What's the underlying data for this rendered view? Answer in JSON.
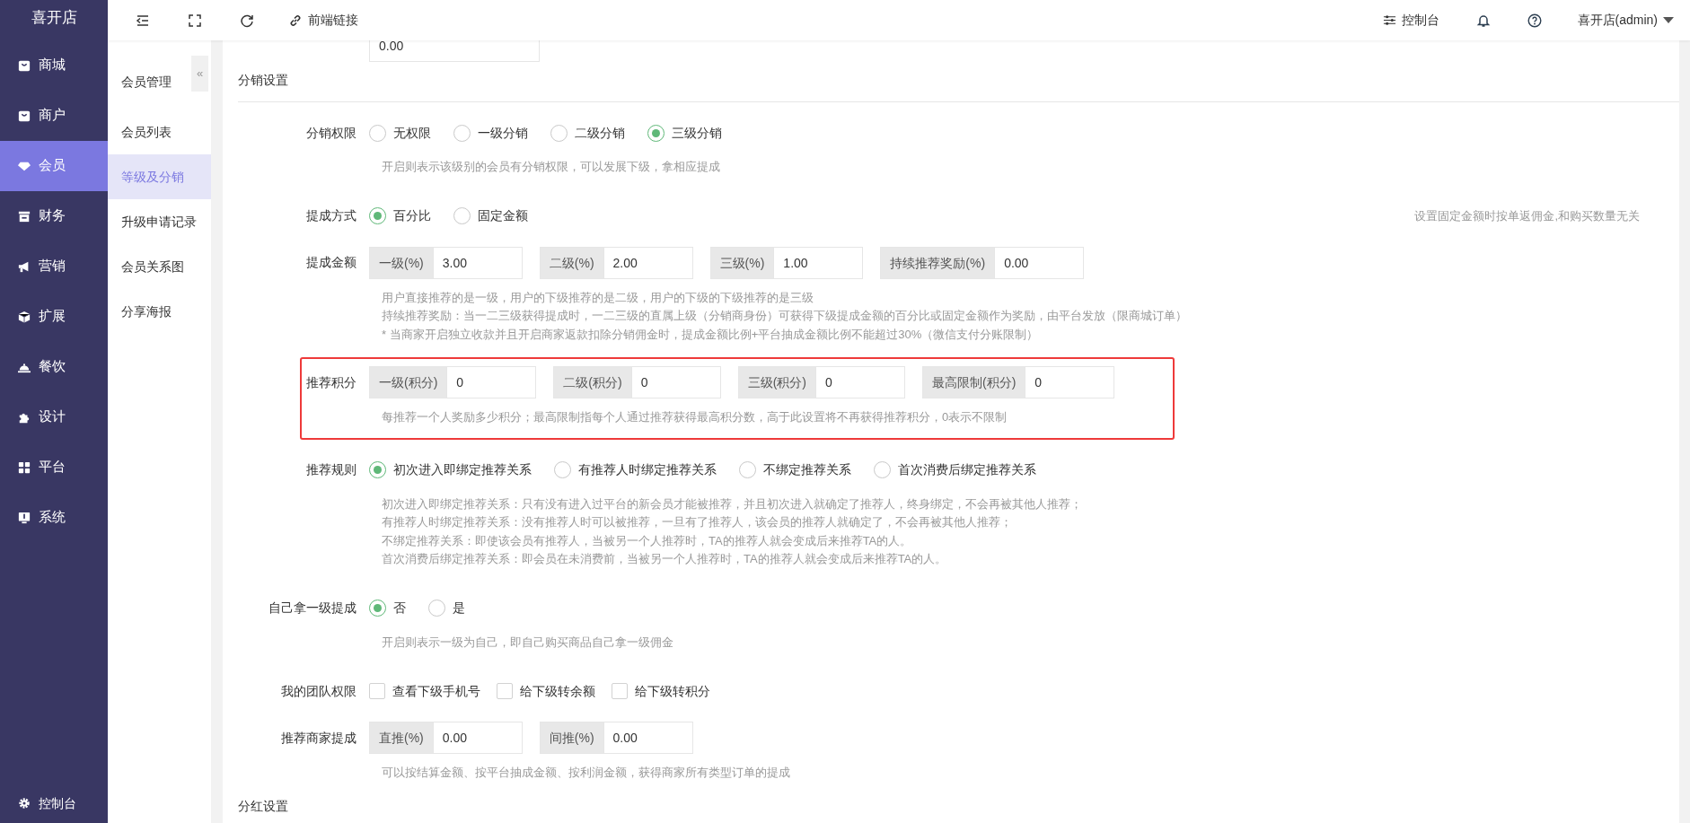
{
  "app": {
    "logo": "喜开店"
  },
  "sidebar": {
    "items": [
      {
        "label": "商城",
        "selected": false
      },
      {
        "label": "商户",
        "selected": false
      },
      {
        "label": "会员",
        "selected": true
      },
      {
        "label": "财务",
        "selected": false
      },
      {
        "label": "营销",
        "selected": false
      },
      {
        "label": "扩展",
        "selected": false
      },
      {
        "label": "餐饮",
        "selected": false
      },
      {
        "label": "设计",
        "selected": false
      },
      {
        "label": "平台",
        "selected": false
      },
      {
        "label": "系统",
        "selected": false
      }
    ],
    "footer": "控制台"
  },
  "toolbar": {
    "link": "前端链接",
    "console": "控制台",
    "user": "喜开店(admin)"
  },
  "subnav": {
    "title": "会员管理",
    "collapse": "«",
    "items": [
      {
        "label": "会员列表",
        "selected": false
      },
      {
        "label": "等级及分销",
        "selected": true
      },
      {
        "label": "升级申请记录",
        "selected": false
      },
      {
        "label": "会员关系图",
        "selected": false
      },
      {
        "label": "分享海报",
        "selected": false
      }
    ]
  },
  "form": [
    {
      "kind": "input",
      "value": "0.00"
    },
    {
      "kind": "section",
      "title": "分销设置"
    },
    {
      "kind": "radio",
      "label": "分销权限",
      "options": [
        {
          "label": "无权限",
          "selected": false
        },
        {
          "label": "一级分销",
          "selected": false
        },
        {
          "label": "二级分销",
          "selected": false
        },
        {
          "label": "三级分销",
          "selected": true
        }
      ],
      "hints": [
        "开启则表示该级别的会员有分销权限，可以发展下级，拿相应提成"
      ]
    },
    {
      "kind": "radio",
      "label": "提成方式",
      "options": [
        {
          "label": "百分比",
          "selected": true
        },
        {
          "label": "固定金额",
          "selected": false
        }
      ],
      "side_note": "设置固定金额时按单返佣金,和购买数量无关"
    },
    {
      "kind": "groups",
      "label": "提成金额",
      "groups": [
        {
          "addon": "一级(%)",
          "value": "3.00"
        },
        {
          "addon": "二级(%)",
          "value": "2.00"
        },
        {
          "addon": "三级(%)",
          "value": "1.00"
        },
        {
          "addon": "持续推荐奖励(%)",
          "value": "0.00"
        }
      ],
      "hints": [
        "用户直接推荐的是一级，用户的下级推荐的是二级，用户的下级的下级推荐的是三级",
        "持续推荐奖励：当一二三级获得提成时，一二三级的直属上级（分销商身份）可获得下级提成金额的百分比或固定金额作为奖励，由平台发放（限商城订单）",
        "* 当商家开启独立收款并且开启商家返款扣除分销佣金时，提成金额比例+平台抽成金额比例不能超过30%（微信支付分账限制）"
      ]
    },
    {
      "kind": "groups",
      "label": "推荐积分",
      "highlighted": true,
      "groups": [
        {
          "addon": "一级(积分)",
          "value": "0"
        },
        {
          "addon": "二级(积分)",
          "value": "0"
        },
        {
          "addon": "三级(积分)",
          "value": "0"
        },
        {
          "addon": "最高限制(积分)",
          "value": "0"
        }
      ],
      "hints": [
        "每推荐一个人奖励多少积分；最高限制指每个人通过推荐获得最高积分数，高于此设置将不再获得推荐积分，0表示不限制"
      ]
    },
    {
      "kind": "radio",
      "label": "推荐规则",
      "options": [
        {
          "label": "初次进入即绑定推荐关系",
          "selected": true
        },
        {
          "label": "有推荐人时绑定推荐关系",
          "selected": false
        },
        {
          "label": "不绑定推荐关系",
          "selected": false
        },
        {
          "label": "首次消费后绑定推荐关系",
          "selected": false
        }
      ],
      "hints": [
        "初次进入即绑定推荐关系：只有没有进入过平台的新会员才能被推荐，并且初次进入就确定了推荐人，终身绑定，不会再被其他人推荐；",
        "有推荐人时绑定推荐关系：没有推荐人时可以被推荐，一旦有了推荐人，该会员的推荐人就确定了，不会再被其他人推荐；",
        "不绑定推荐关系：即使该会员有推荐人，当被另一个人推荐时，TA的推荐人就会变成后来推荐TA的人。",
        "首次消费后绑定推荐关系：即会员在未消费前，当被另一个人推荐时，TA的推荐人就会变成后来推荐TA的人。"
      ]
    },
    {
      "kind": "radio",
      "label": "自己拿一级提成",
      "options": [
        {
          "label": "否",
          "selected": true
        },
        {
          "label": "是",
          "selected": false
        }
      ],
      "hints": [
        "开启则表示一级为自己，即自己购买商品自己拿一级佣金"
      ]
    },
    {
      "kind": "checkbox",
      "label": "我的团队权限",
      "options": [
        {
          "label": "查看下级手机号",
          "checked": false
        },
        {
          "label": "给下级转余额",
          "checked": false
        },
        {
          "label": "给下级转积分",
          "checked": false
        }
      ]
    },
    {
      "kind": "groups",
      "label": "推荐商家提成",
      "groups": [
        {
          "addon": "直推(%)",
          "value": "0.00"
        },
        {
          "addon": "间推(%)",
          "value": "0.00"
        }
      ],
      "hints": [
        "可以按结算金额、按平台抽成金额、按利润金额，获得商家所有类型订单的提成"
      ]
    },
    {
      "kind": "section",
      "title": "分红设置"
    }
  ]
}
